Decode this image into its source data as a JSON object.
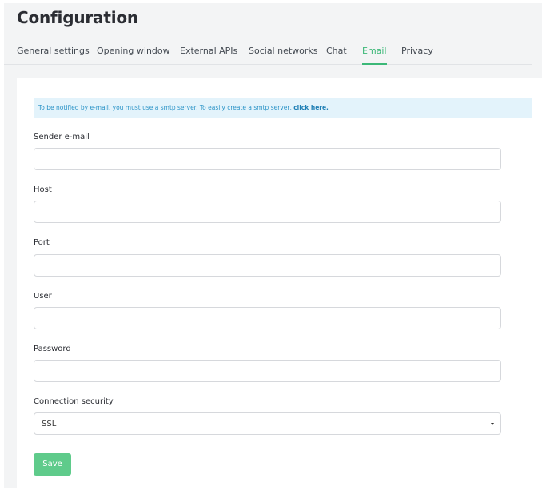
{
  "page": {
    "title": "Configuration"
  },
  "tabs": [
    {
      "label": "General settings"
    },
    {
      "label": "Opening window"
    },
    {
      "label": "External APIs"
    },
    {
      "label": "Social networks"
    },
    {
      "label": "Chat"
    },
    {
      "label": "Email",
      "active": true
    },
    {
      "label": "Privacy"
    }
  ],
  "alert": {
    "text": "To be notified by e-mail, you must use a smtp server. To easily create a smtp server, ",
    "link_text": "click here."
  },
  "form": {
    "sender_email": {
      "label": "Sender e-mail",
      "value": ""
    },
    "host": {
      "label": "Host",
      "value": ""
    },
    "port": {
      "label": "Port",
      "value": ""
    },
    "user": {
      "label": "User",
      "value": ""
    },
    "password": {
      "label": "Password",
      "value": ""
    },
    "connection_security": {
      "label": "Connection security",
      "selected": "SSL"
    }
  },
  "actions": {
    "save_label": "Save"
  },
  "colors": {
    "accent": "#3cb878",
    "button": "#5fcb8b",
    "alert_bg": "#e3f3fb",
    "alert_text": "#2a93c7"
  }
}
